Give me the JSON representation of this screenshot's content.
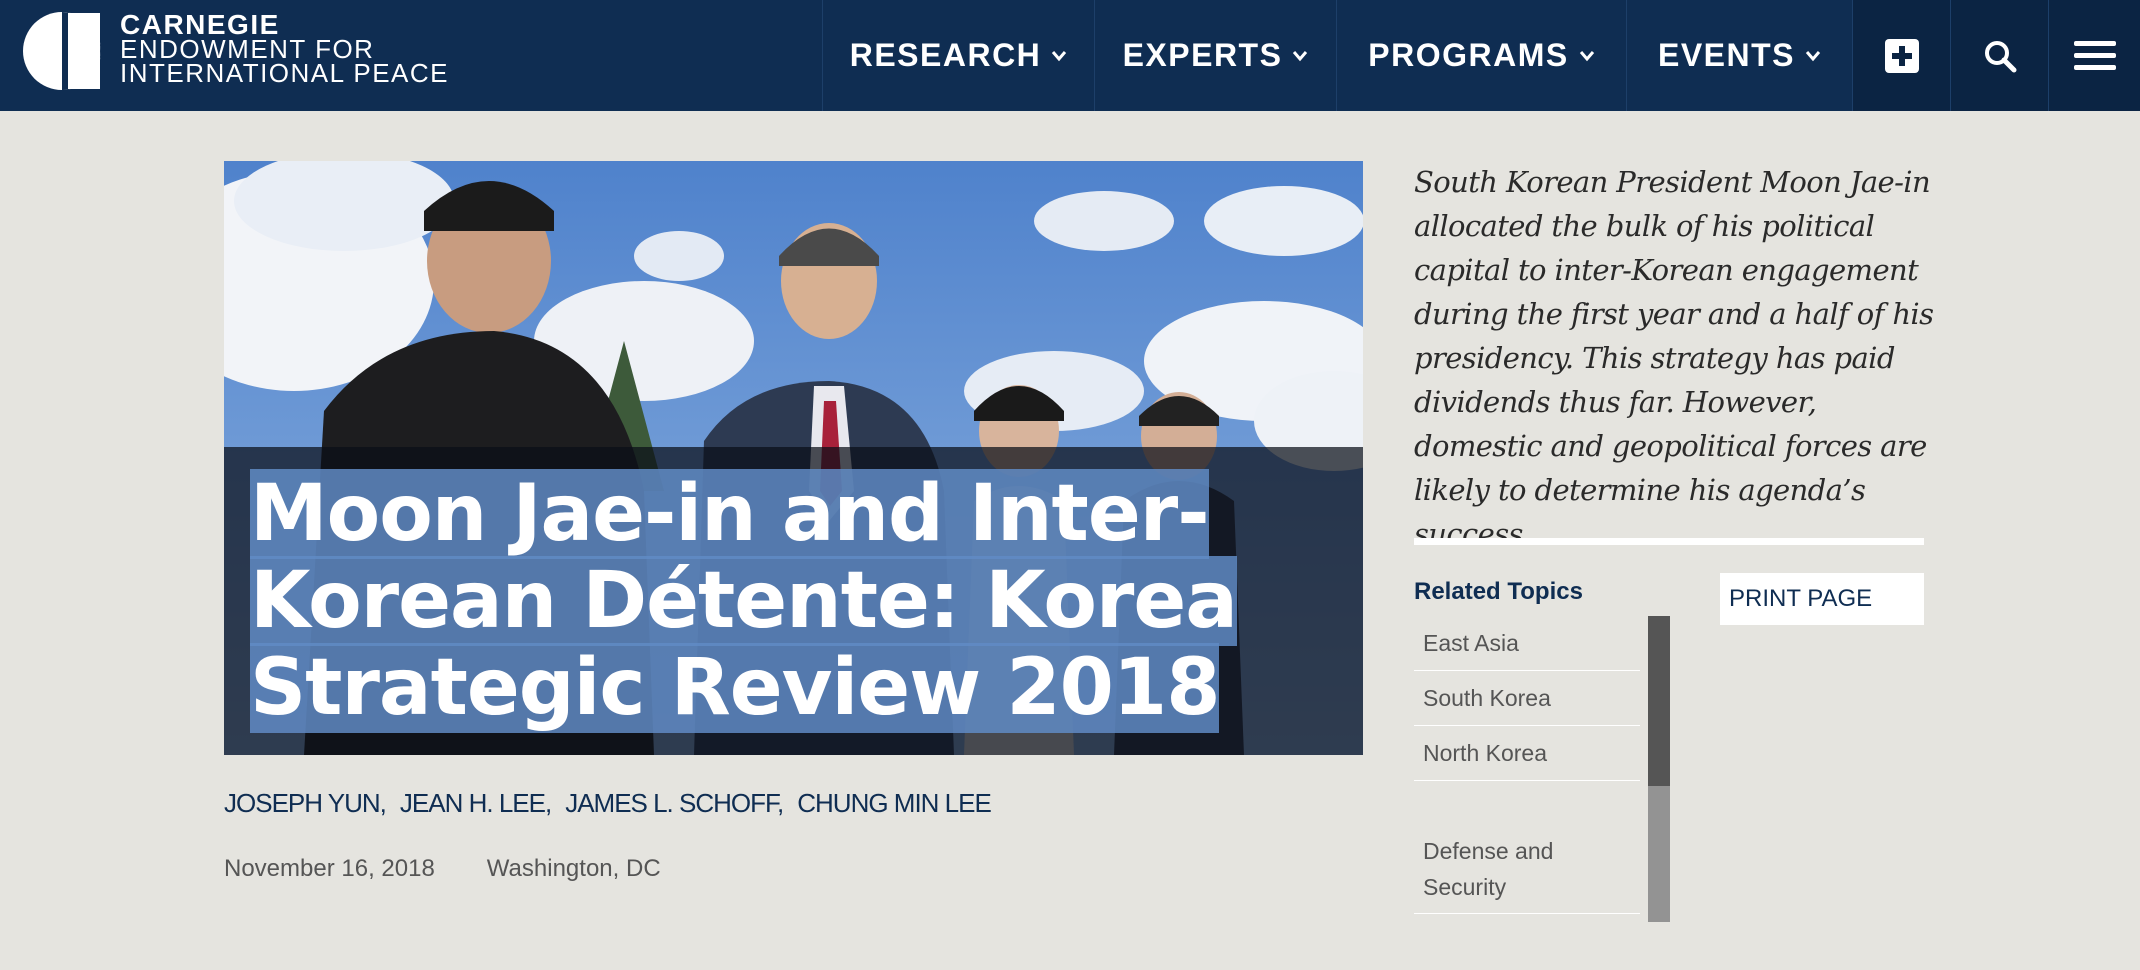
{
  "header": {
    "logo_line1": "CARNEGIE",
    "logo_line2": "ENDOWMENT FOR",
    "logo_line3": "INTERNATIONAL PEACE",
    "nav": [
      {
        "label": "RESEARCH"
      },
      {
        "label": "EXPERTS"
      },
      {
        "label": "PROGRAMS"
      },
      {
        "label": "EVENTS"
      }
    ],
    "icons": [
      "plus-icon",
      "search-icon",
      "menu-icon"
    ]
  },
  "article": {
    "title_line1": "Moon Jae-in and Inter-",
    "title_line2": "Korean Détente: Korea",
    "title_line3": "Strategic Review 2018",
    "authors": [
      "JOSEPH YUN,",
      "JEAN H. LEE,",
      "JAMES L. SCHOFF,",
      "CHUNG MIN LEE"
    ],
    "date": "November 16, 2018",
    "location": "Washington, DC",
    "summary": "South Korean President Moon Jae-in allocated the bulk of his political capital to inter-Korean engagement during the first year and a half of his presidency. This strategy has paid dividends thus far. However, domestic and geopolitical forces are likely to determine his agenda’s success."
  },
  "sidebar": {
    "related_title": "Related Topics",
    "topics": [
      "East Asia",
      "South Korea",
      "North Korea",
      "Defense and Security"
    ],
    "print_label": "PRINT PAGE"
  },
  "colors": {
    "header_bg": "#0f2d52",
    "page_bg": "#e5e4df",
    "title_highlight": "#608bc4"
  }
}
